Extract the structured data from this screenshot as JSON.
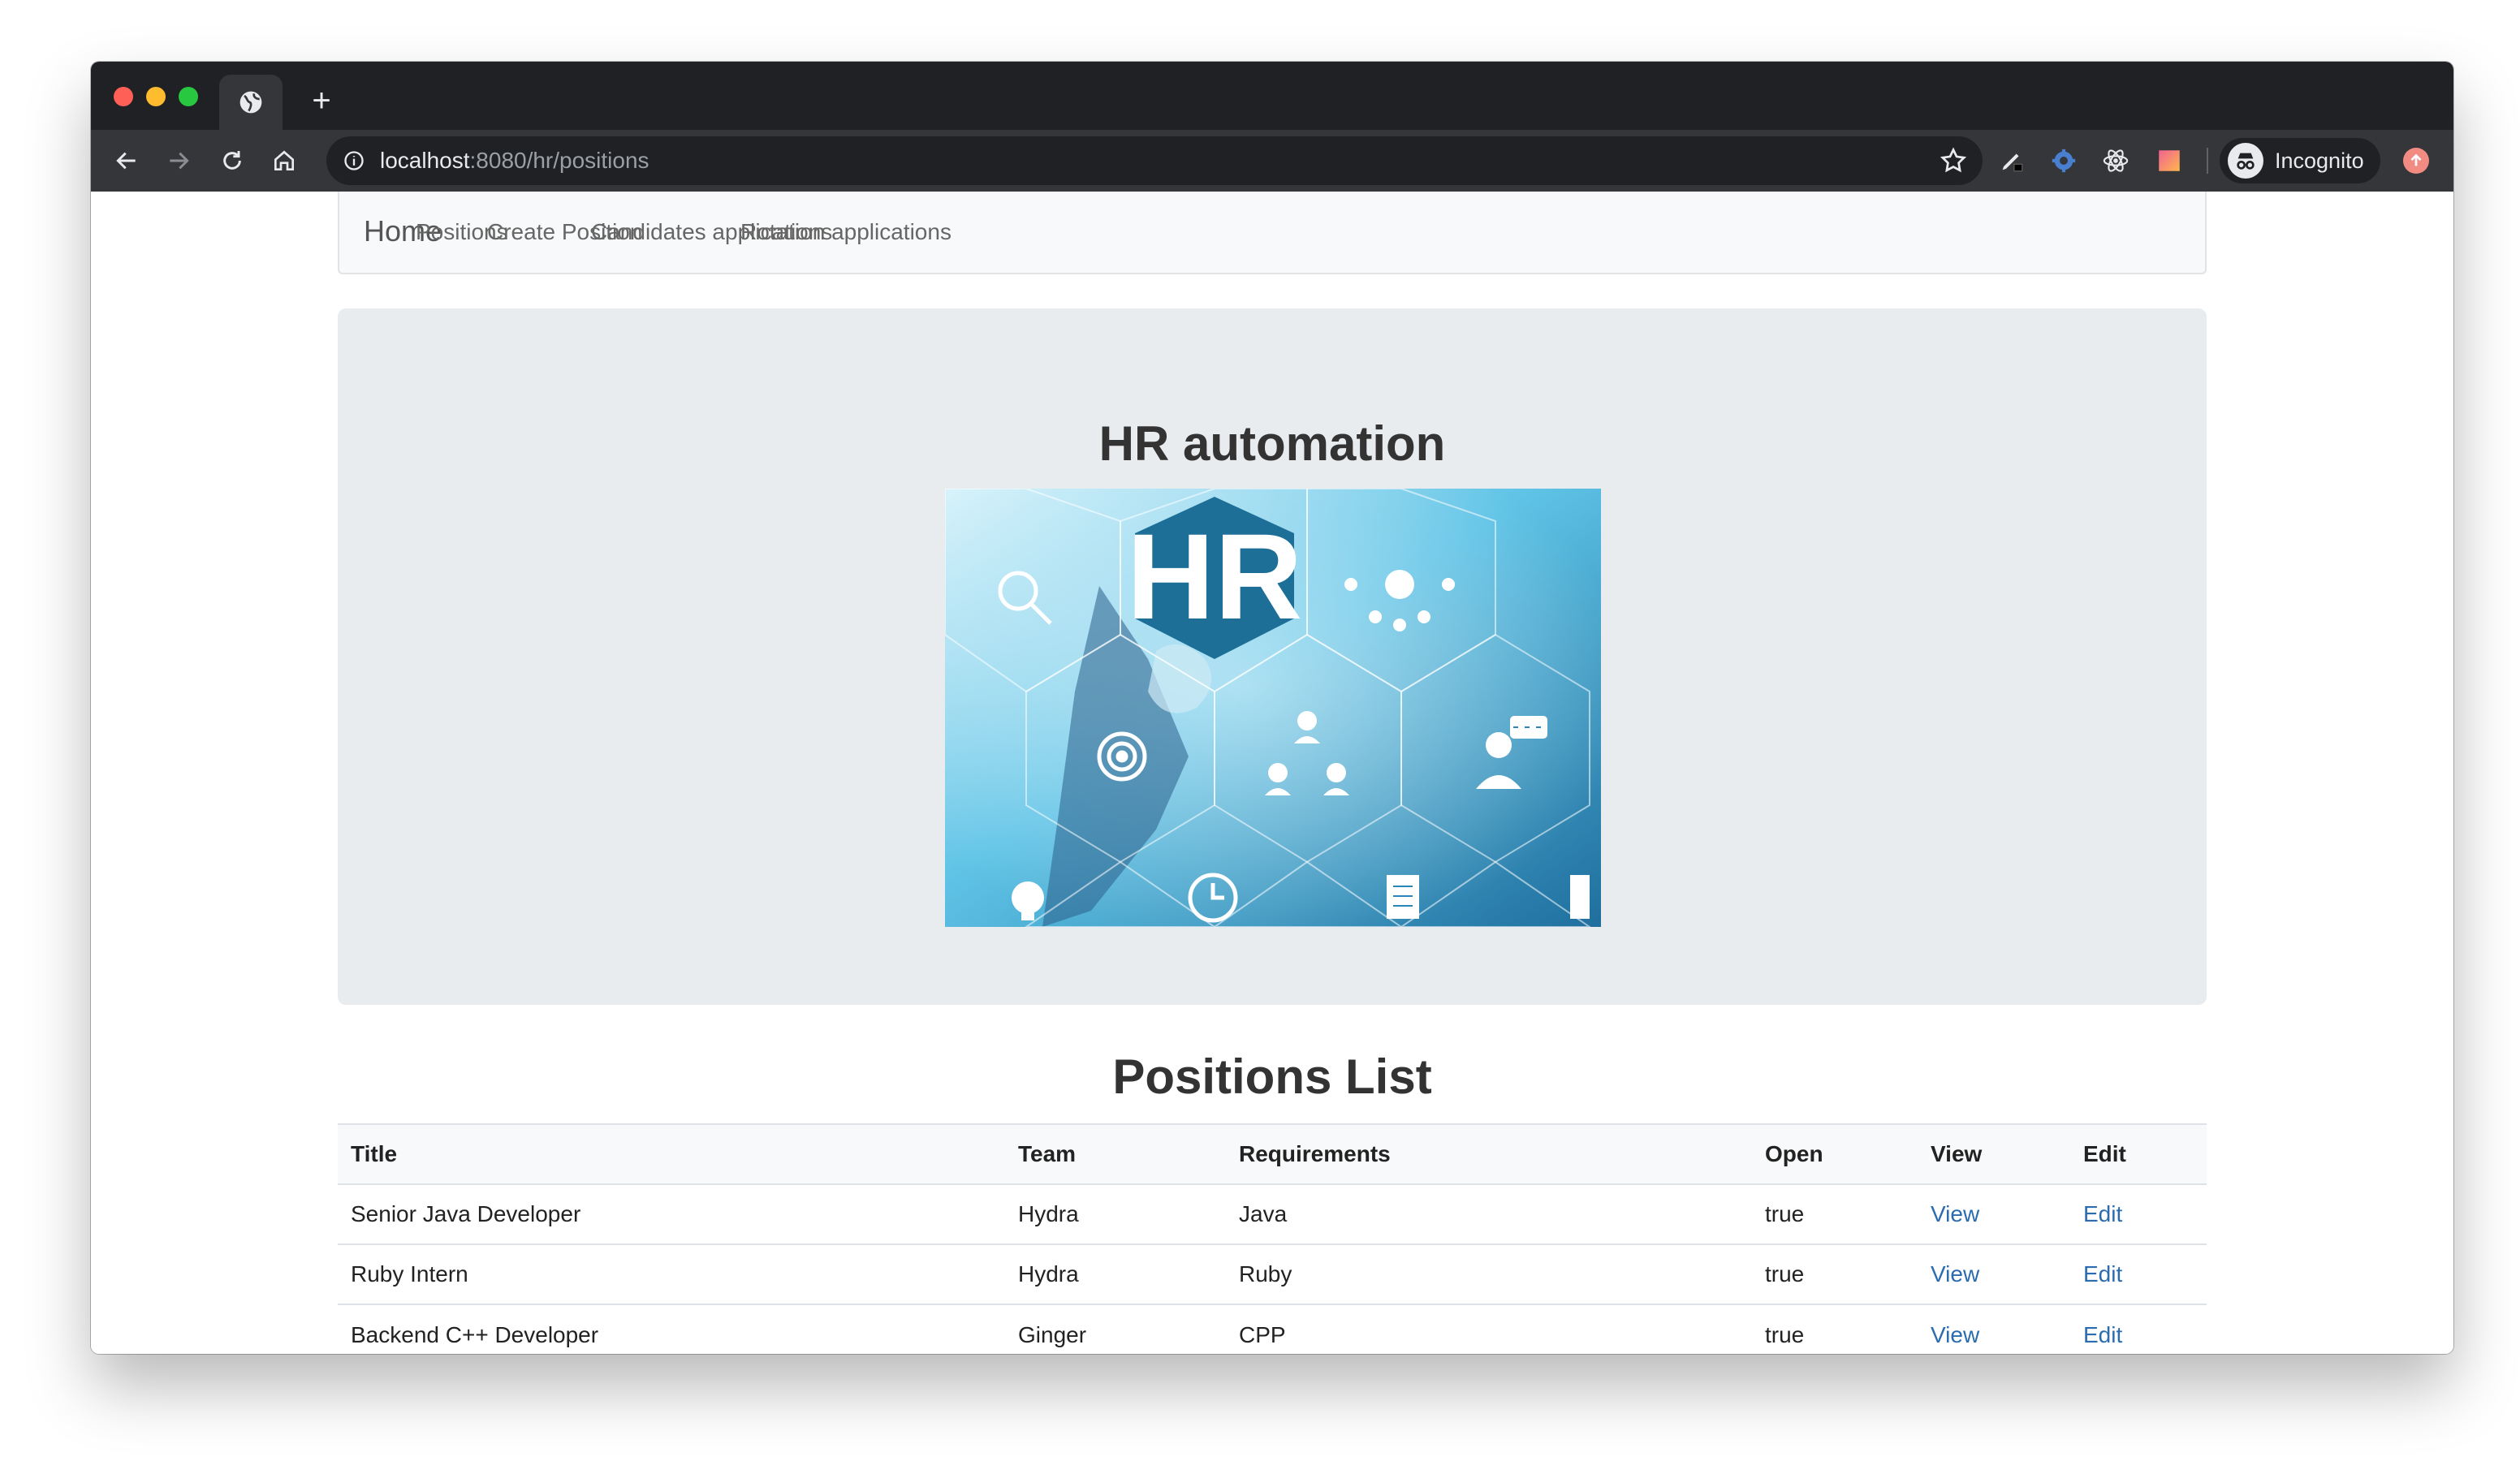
{
  "browser": {
    "address": {
      "host": "localhost",
      "rest": ":8080/hr/positions"
    },
    "profile_label": "Incognito"
  },
  "nav": {
    "brand": "Home",
    "links": [
      "Positions",
      "Create Position",
      "Candidates applications",
      "Rotation applications"
    ]
  },
  "hero": {
    "title": "HR automation",
    "image_text": "HR"
  },
  "positions": {
    "title": "Positions List",
    "headers": [
      "Title",
      "Team",
      "Requirements",
      "Open",
      "View",
      "Edit"
    ],
    "rows": [
      {
        "title": "Senior Java Developer",
        "team": "Hydra",
        "requirements": "Java",
        "open": "true",
        "view": "View",
        "edit": "Edit"
      },
      {
        "title": "Ruby Intern",
        "team": "Hydra",
        "requirements": "Ruby",
        "open": "true",
        "view": "View",
        "edit": "Edit"
      },
      {
        "title": "Backend C++ Developer",
        "team": "Ginger",
        "requirements": "CPP",
        "open": "true",
        "view": "View",
        "edit": "Edit"
      }
    ]
  },
  "colors": {
    "chrome_dark": "#202124",
    "toolbar": "#35363a",
    "link": "#2b6cb0",
    "jumbotron": "#e9ecef"
  }
}
